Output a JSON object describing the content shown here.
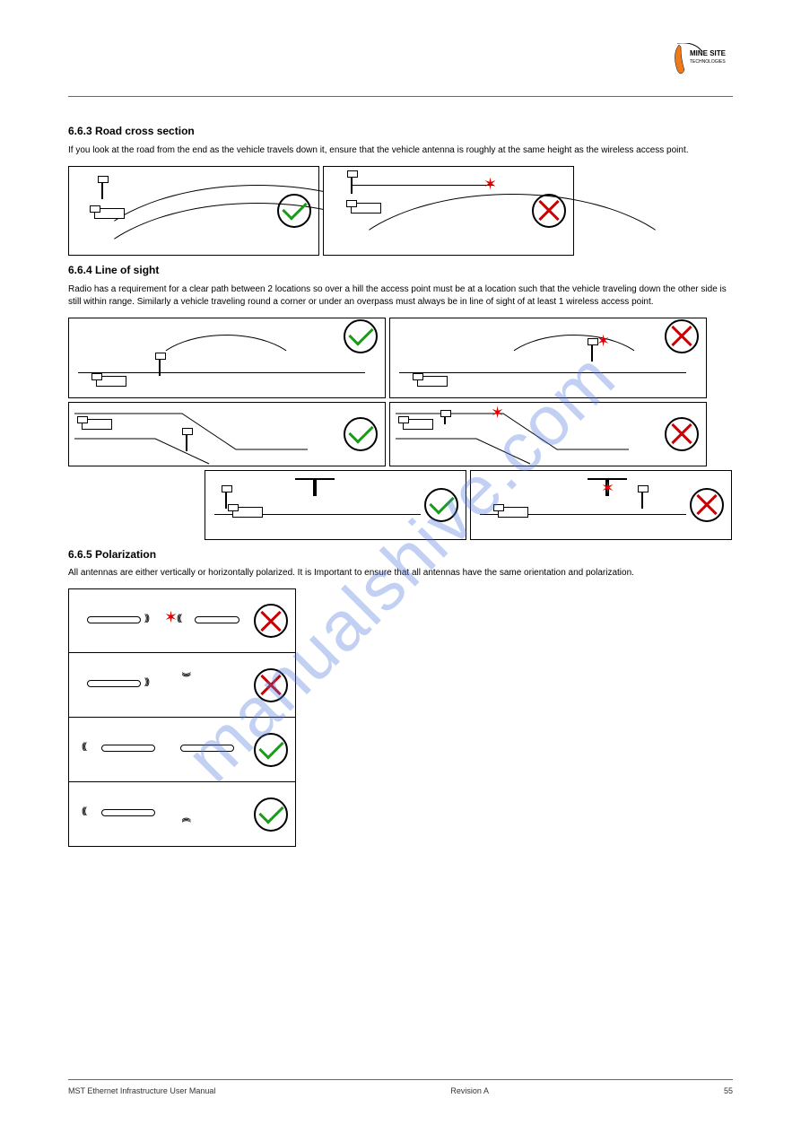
{
  "header": {
    "logo_alt": "MINE SITE TECHNOLOGIES"
  },
  "sections": {
    "road_cross": {
      "heading": "6.6.3 Road cross section",
      "text": "If you look at the road from the end as the vehicle travels down it, ensure that the vehicle antenna is roughly at the same height as the wireless access point."
    },
    "line_of_sight": {
      "heading": "6.6.4 Line of sight",
      "text": "Radio has a requirement for a clear path between 2 locations so over a hill the access point must be at a location such that the vehicle traveling down the other side is still within range. Similarly a vehicle traveling round a corner or under an overpass must always be in line of sight of at least 1 wireless access point."
    },
    "polarization": {
      "heading": "6.6.5 Polarization",
      "text": "All antennas are either vertically or horizontally polarized. It is Important to ensure that all antennas have the same orientation and polarization."
    }
  },
  "watermark": "manualshive.com",
  "footer": {
    "left": "MST Ethernet Infrastructure User Manual",
    "center": "Revision A",
    "right": "55"
  }
}
